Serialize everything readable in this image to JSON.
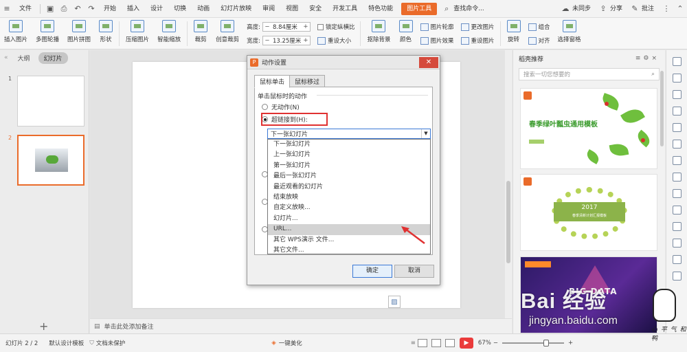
{
  "menubar": {
    "file": "文件",
    "tabs": [
      "开始",
      "插入",
      "设计",
      "切换",
      "动画",
      "幻灯片放映",
      "审阅",
      "视图",
      "安全",
      "开发工具",
      "特色功能"
    ],
    "active_tab": "图片工具",
    "search": "查找命令...",
    "sync": "未同步",
    "share": "分享",
    "comment": "批注"
  },
  "ribbon": {
    "insert_picture": "插入图片",
    "multi_outline": "多图轮播",
    "picture_collage": "图片拼图",
    "shape": "形状",
    "compress_picture": "压缩图片",
    "smart_scale": "智能缩放",
    "crop": "裁剪",
    "creative_crop": "创意裁剪",
    "height_label": "高度:",
    "height_value": "8.84厘米",
    "width_label": "宽度:",
    "width_value": "13.25厘米",
    "lock_ratio": "锁定纵横比",
    "reset_size": "重设大小",
    "remove_bg": "抠除背景",
    "color": "颜色",
    "picture_outline": "图片轮廓",
    "picture_effect": "图片效果",
    "change_picture": "更改图片",
    "reset_picture": "重设图片",
    "rotate": "旋转",
    "combine": "组合",
    "align": "对齐",
    "selection_pane": "选择窗格"
  },
  "left_panel": {
    "tab_outline": "大纲",
    "tab_slides": "幻灯片",
    "slide_numbers": [
      "1",
      "2"
    ],
    "add": "+"
  },
  "canvas": {
    "notes_placeholder": "单击此处添加备注"
  },
  "dialog": {
    "title": "动作设置",
    "tab_click": "鼠标单击",
    "tab_hover": "鼠标移过",
    "group_label": "单击鼠标时的动作",
    "option_none": "无动作(N)",
    "option_hyperlink": "超链接到(H):",
    "combo_value": "下一张幻灯片",
    "dropdown_options": [
      "下一张幻灯片",
      "上一张幻灯片",
      "第一张幻灯片",
      "最后一张幻灯片",
      "最近观看的幻灯片",
      "结束放映",
      "自定义放映...",
      "幻灯片...",
      "URL...",
      "其它 WPS演示 文件...",
      "其它文件..."
    ],
    "hover_option_index": 8,
    "ok": "确定",
    "cancel": "取消"
  },
  "right_panel": {
    "title": "稻壳推荐",
    "search_placeholder": "搜索一切您想要的",
    "tpl1_title": "春季绿叶瓢虫通用模板",
    "tpl2_year": "2017",
    "tpl2_sub": "春季清新计划汇报模板",
    "tpl3_text": "BIG DATA"
  },
  "statusbar": {
    "slide_info": "幻灯片 2 / 2",
    "template": "默认设计模板",
    "doc_status": "文档未保护",
    "beautify": "一键美化",
    "zoom": "67%"
  },
  "watermark": {
    "brand": "Bai 经验",
    "url": "jingyan.baidu.com",
    "signature": "心 平 气 和 鸭"
  },
  "colors": {
    "accent": "#ea6b2a",
    "highlight_box": "#e03131",
    "hover_row": "#d3d3d3"
  }
}
